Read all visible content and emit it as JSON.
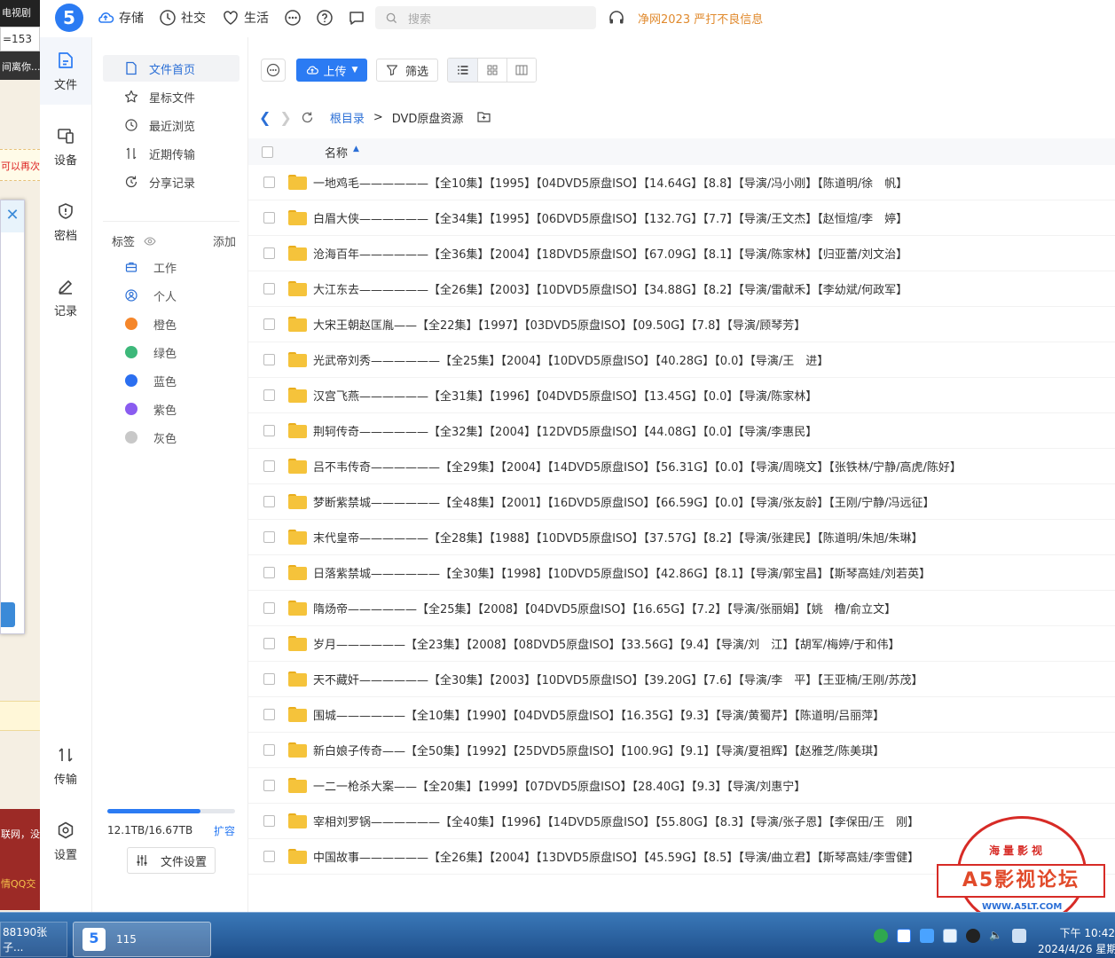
{
  "background_window": {
    "title": "电视剧",
    "url": "=153",
    "nav": "间离你...",
    "warning": "可以再次",
    "footer_text": "联网，没",
    "footer_link": "情QQ交"
  },
  "header": {
    "logo": "5",
    "nav": [
      {
        "label": "存储",
        "icon": "cloud-icon"
      },
      {
        "label": "社交",
        "icon": "compass-icon"
      },
      {
        "label": "生活",
        "icon": "heart-icon"
      }
    ],
    "search_placeholder": "搜索",
    "notice": "净网2023 严打不良信息"
  },
  "rail": {
    "items": [
      {
        "label": "文件",
        "icon": "file-icon",
        "active": true
      },
      {
        "label": "设备",
        "icon": "device-icon"
      },
      {
        "label": "密档",
        "icon": "shield-icon"
      },
      {
        "label": "记录",
        "icon": "edit-icon"
      },
      {
        "label": "传输",
        "icon": "transfer-icon"
      },
      {
        "label": "设置",
        "icon": "gear-icon"
      }
    ]
  },
  "sidebar": {
    "items": [
      {
        "label": "文件首页",
        "active": true
      },
      {
        "label": "星标文件"
      },
      {
        "label": "最近浏览"
      },
      {
        "label": "近期传输"
      },
      {
        "label": "分享记录"
      }
    ],
    "tags_title": "标签",
    "tags_add": "添加",
    "tags": [
      {
        "label": "工作",
        "kind": "briefcase"
      },
      {
        "label": "个人",
        "kind": "person"
      },
      {
        "label": "橙色",
        "color": "#f5862a"
      },
      {
        "label": "绿色",
        "color": "#3db87a"
      },
      {
        "label": "蓝色",
        "color": "#2b6ff0"
      },
      {
        "label": "紫色",
        "color": "#8a5cf0"
      },
      {
        "label": "灰色",
        "color": "#c8c8c8"
      }
    ],
    "quota_used_fraction": 0.726,
    "quota_text": "12.1TB/16.67TB",
    "quota_expand": "扩容",
    "settings_button": "文件设置"
  },
  "toolbar": {
    "upload": "上传",
    "filter": "筛选"
  },
  "breadcrumb": {
    "root": "根目录",
    "sep": ">",
    "current": "DVD原盘资源"
  },
  "list": {
    "column_name": "名称",
    "rows": [
      {
        "name": "一地鸡毛——————【全10集】【1995】【04DVD5原盘ISO】【14.64G】【8.8】【导演/冯小刚】【陈道明/徐　帆】"
      },
      {
        "name": "白眉大侠——————【全34集】【1995】【06DVD5原盘ISO】【132.7G】【7.7】【导演/王文杰】【赵恒煊/李　婷】"
      },
      {
        "name": "沧海百年——————【全36集】【2004】【18DVD5原盘ISO】【67.09G】【8.1】【导演/陈家林】【归亚蕾/刘文治】"
      },
      {
        "name": "大江东去——————【全26集】【2003】【10DVD5原盘ISO】【34.88G】【8.2】【导演/雷献禾】【李幼斌/何政军】"
      },
      {
        "name": "大宋王朝赵匡胤——【全22集】【1997】【03DVD5原盘ISO】【09.50G】【7.8】【导演/顾琴芳】"
      },
      {
        "name": "光武帝刘秀——————【全25集】【2004】【10DVD5原盘ISO】【40.28G】【0.0】【导演/王　进】"
      },
      {
        "name": "汉宫飞燕——————【全31集】【1996】【04DVD5原盘ISO】【13.45G】【0.0】【导演/陈家林】"
      },
      {
        "name": "荆轲传奇——————【全32集】【2004】【12DVD5原盘ISO】【44.08G】【0.0】【导演/李惠民】"
      },
      {
        "name": "吕不韦传奇——————【全29集】【2004】【14DVD5原盘ISO】【56.31G】【0.0】【导演/周晓文】【张铁林/宁静/高虎/陈好】"
      },
      {
        "name": "梦断紫禁城——————【全48集】【2001】【16DVD5原盘ISO】【66.59G】【0.0】【导演/张友龄】【王刚/宁静/冯远征】"
      },
      {
        "name": "末代皇帝——————【全28集】【1988】【10DVD5原盘ISO】【37.57G】【8.2】【导演/张建民】【陈道明/朱旭/朱琳】"
      },
      {
        "name": "日落紫禁城——————【全30集】【1998】【10DVD5原盘ISO】【42.86G】【8.1】【导演/郭宝昌】【斯琴高娃/刘若英】"
      },
      {
        "name": "隋炀帝——————【全25集】【2008】【04DVD5原盘ISO】【16.65G】【7.2】【导演/张丽娟】【姚　橹/俞立文】"
      },
      {
        "name": "岁月——————【全23集】【2008】【08DVD5原盘ISO】【33.56G】【9.4】【导演/刘　江】【胡军/梅婷/于和伟】"
      },
      {
        "name": "天不藏奸——————【全30集】【2003】【10DVD5原盘ISO】【39.20G】【7.6】【导演/李　平】【王亚楠/王刚/苏茂】"
      },
      {
        "name": "围城——————【全10集】【1990】【04DVD5原盘ISO】【16.35G】【9.3】【导演/黄蜀芹】【陈道明/吕丽萍】"
      },
      {
        "name": "新白娘子传奇——【全50集】【1992】【25DVD5原盘ISO】【100.9G】【9.1】【导演/夏祖辉】【赵雅芝/陈美琪】"
      },
      {
        "name": "一二一枪杀大案——【全20集】【1999】【07DVD5原盘ISO】【28.40G】【9.3】【导演/刘惠宁】"
      },
      {
        "name": "宰相刘罗锅——————【全40集】【1996】【14DVD5原盘ISO】【55.80G】【8.3】【导演/张子恩】【李保田/王　刚】"
      },
      {
        "name": "中国故事——————【全26集】【2004】【13DVD5原盘ISO】【45.59G】【8.5】【导演/曲立君】【斯琴高娃/李雪健】"
      }
    ]
  },
  "watermark": {
    "top": "海量影视",
    "title": "A5影视论坛",
    "url": "WWW.A5LT.COM"
  },
  "taskbar": {
    "task1": "88190张子...",
    "task2_icon": "5",
    "task2": "115",
    "time": "下午 10:42",
    "date": "2024/4/26 星期"
  }
}
